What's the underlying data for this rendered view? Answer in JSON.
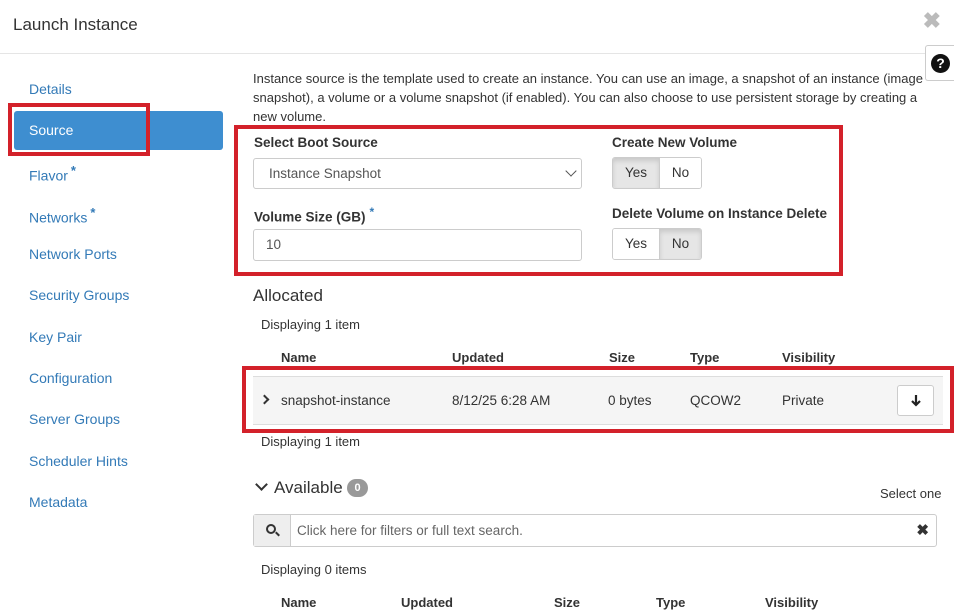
{
  "header": {
    "title": "Launch Instance",
    "close_glyph": "✖",
    "help_glyph": "?"
  },
  "sidebar": {
    "items": [
      {
        "label": "Details",
        "required": false
      },
      {
        "label": "Source",
        "required": false,
        "active": true
      },
      {
        "label": "Flavor",
        "required": true
      },
      {
        "label": "Networks",
        "required": true
      },
      {
        "label": "Network Ports",
        "required": false
      },
      {
        "label": "Security Groups",
        "required": false
      },
      {
        "label": "Key Pair",
        "required": false
      },
      {
        "label": "Configuration",
        "required": false
      },
      {
        "label": "Server Groups",
        "required": false
      },
      {
        "label": "Scheduler Hints",
        "required": false
      },
      {
        "label": "Metadata",
        "required": false
      }
    ],
    "required_marker": "*"
  },
  "intro": "Instance source is the template used to create an instance. You can use an image, a snapshot of an instance (image snapshot), a volume or a volume snapshot (if enabled). You can also choose to use persistent storage by creating a new volume.",
  "form": {
    "boot_source_label": "Select Boot Source",
    "boot_source_value": "Instance Snapshot",
    "volume_size_label": "Volume Size (GB)",
    "volume_size_value": "10",
    "create_volume_label": "Create New Volume",
    "create_volume_options": [
      "Yes",
      "No"
    ],
    "create_volume_selected": "Yes",
    "delete_volume_label": "Delete Volume on Instance Delete",
    "delete_volume_options": [
      "Yes",
      "No"
    ],
    "delete_volume_selected": "No"
  },
  "allocated": {
    "title": "Allocated",
    "count_text": "Displaying 1 item",
    "columns": [
      "Name",
      "Updated",
      "Size",
      "Type",
      "Visibility"
    ],
    "rows": [
      {
        "name": "snapshot-instance",
        "updated": "8/12/25 6:28 AM",
        "size": "0 bytes",
        "type": "QCOW2",
        "visibility": "Private"
      }
    ],
    "footer_count_text": "Displaying 1 item",
    "action_icon": "arrow-down-icon"
  },
  "available": {
    "title": "Available",
    "badge": "0",
    "select_hint": "Select one",
    "search_placeholder": "Click here for filters or full text search.",
    "clear_glyph": "✖",
    "count_text": "Displaying 0 items",
    "columns": [
      "Name",
      "Updated",
      "Size",
      "Type",
      "Visibility"
    ]
  },
  "colors": {
    "accent": "#3e8ed0",
    "link": "#337ab7",
    "highlight": "#d3212a"
  }
}
